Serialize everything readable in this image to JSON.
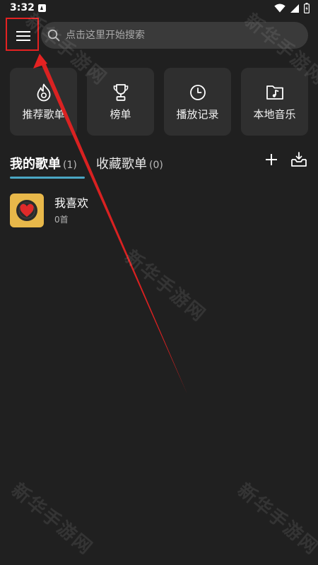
{
  "status_bar": {
    "time": "3:32"
  },
  "search": {
    "placeholder": "点击这里开始搜索"
  },
  "quick_actions": [
    {
      "label": "推荐歌单",
      "icon": "flame-icon"
    },
    {
      "label": "榜单",
      "icon": "trophy-icon"
    },
    {
      "label": "播放记录",
      "icon": "clock-icon"
    },
    {
      "label": "本地音乐",
      "icon": "music-folder-icon"
    }
  ],
  "tabs": [
    {
      "title": "我的歌单",
      "count": "(1)"
    },
    {
      "title": "收藏歌单",
      "count": "(0)"
    }
  ],
  "playlists": [
    {
      "name": "我喜欢",
      "count": "0首"
    }
  ],
  "watermark": "新华手游网",
  "colors": {
    "accent": "#4aa7c4",
    "annotation": "#e42222",
    "background": "#202020",
    "card": "#2f2f2f",
    "cover": "#e8b84a"
  }
}
